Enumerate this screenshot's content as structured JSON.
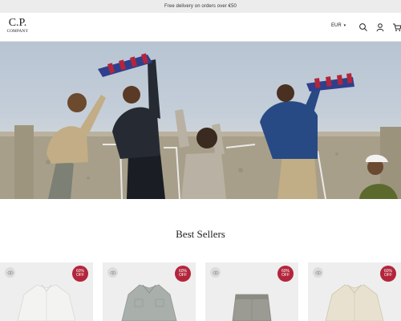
{
  "announcement": "Free delivery on orders over €50",
  "brand": {
    "line1": "C.P.",
    "line2": "COMPANY"
  },
  "header": {
    "currency": "EUR"
  },
  "icons": {
    "caret": "chevron-down-icon",
    "search": "search-icon",
    "account": "user-icon",
    "cart": "cart-icon",
    "quickview": "eye-icon"
  },
  "section": {
    "title": "Best Sellers"
  },
  "products": [
    {
      "discount": "60%",
      "off_label": "OFF",
      "garment_color": "#f3f3f1"
    },
    {
      "discount": "60%",
      "off_label": "OFF",
      "garment_color": "#a9afab"
    },
    {
      "discount": "60%",
      "off_label": "OFF",
      "garment_color": "#9c9b93"
    },
    {
      "discount": "60%",
      "off_label": "OFF",
      "garment_color": "#e9e1cf"
    }
  ],
  "colors": {
    "badge": "#b3253b",
    "announce_bg": "#ececec"
  }
}
